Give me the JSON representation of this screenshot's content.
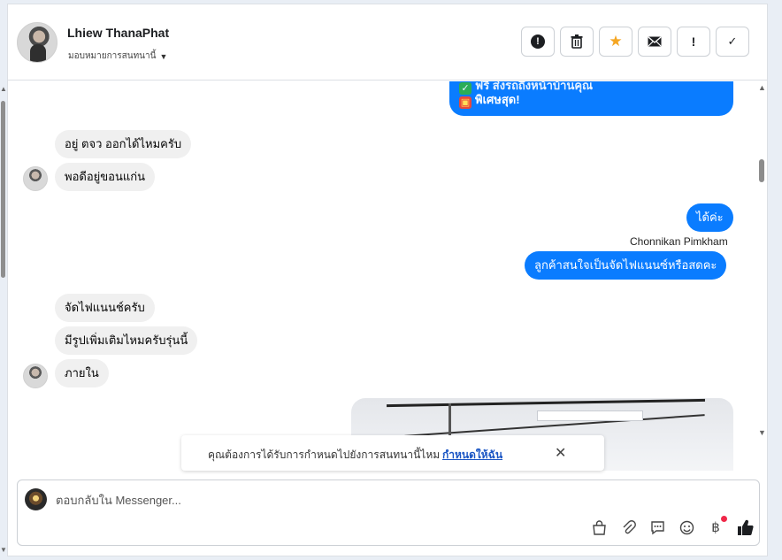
{
  "header": {
    "contact_name": "Lhiew ThanaPhat",
    "assign_label": "มอบหมายการสนทนานี้",
    "actions": [
      "mark-spam",
      "delete",
      "star",
      "mark-unread",
      "follow-up",
      "done"
    ]
  },
  "messages": {
    "promo_line1": "ฟรี ส่งรถถึงหน้าบ้านคุณ",
    "promo_line2": "พิเศษสุด!",
    "in1": "อยู่ ตจว ออกได้ไหมครับ",
    "in2": "พอดีอยู่ขอนแก่น",
    "out1": "ได้ค่ะ",
    "agent_name": "Chonnikan Pimkham",
    "out2": "ลูกค้าสนใจเป็นจัดไฟแนนซ์หรือสดคะ",
    "in3": "จัดไฟแนนช์ครับ",
    "in4": "มีรูปเพิ่มเติมไหมครับรุ่นนี้",
    "in5": "ภายใน"
  },
  "reminder": {
    "text": "คุณต้องการได้รับการกำหนดไปยังการสนทนานี้ไหม",
    "link": "กำหนดให้ฉัน"
  },
  "composer": {
    "placeholder": "ตอบกลับใน Messenger...",
    "tools": [
      "shop-icon",
      "attach-icon",
      "saved-reply-icon",
      "emoji-icon",
      "payment-icon",
      "like-icon"
    ]
  },
  "colors": {
    "outgoing": "#0a7cff",
    "incoming": "#f0f0f0",
    "star": "#f5a623",
    "link": "#1a55c4"
  }
}
